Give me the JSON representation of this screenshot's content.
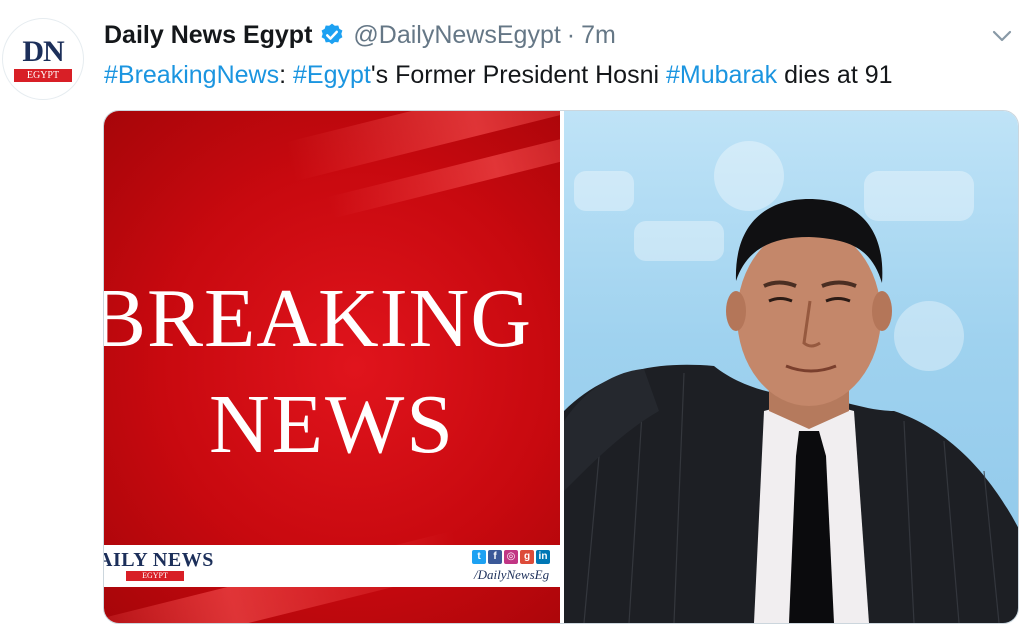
{
  "tweet": {
    "display_name": "Daily News Egypt",
    "handle": "@DailyNewsEgypt",
    "separator": "·",
    "time": "7m",
    "verified_icon": "verified-badge-icon",
    "caret_icon": "chevron-down-icon",
    "text_parts": {
      "tag1": "#BreakingNews",
      "sep1": ": ",
      "tag2": "#Egypt",
      "mid": "'s Former President Hosni ",
      "tag3": "#Mubarak",
      "end": " dies at 91"
    }
  },
  "avatar": {
    "logo_top": "DN",
    "logo_bottom": "EGYPT"
  },
  "media": {
    "left_image": {
      "line1": "BREAKING",
      "line2": "NEWS",
      "brand": "AILY NEWS",
      "brand_sub": "EGYPT",
      "url": "/DailyNewsEg",
      "social_icons": [
        "twitter-icon",
        "facebook-icon",
        "instagram-icon",
        "googleplus-icon",
        "linkedin-icon"
      ]
    },
    "right_image": {
      "subject": "photo-of-hosni-mubarak"
    }
  },
  "colors": {
    "link": "#1b95e0",
    "text": "#14171a",
    "muted": "#657786",
    "breaking_red": "#d0080e",
    "verified": "#1da1f2"
  }
}
